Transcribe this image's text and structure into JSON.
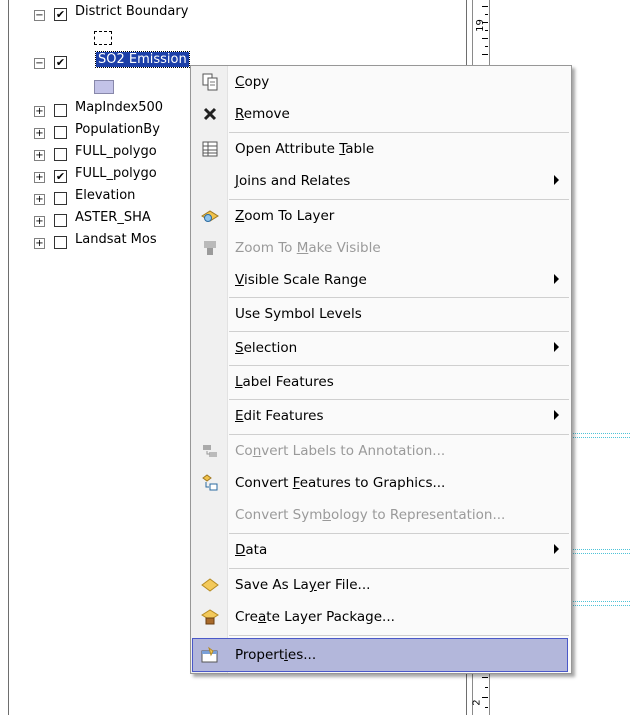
{
  "toc": {
    "layers": [
      {
        "name": "District Boundary",
        "checked": true,
        "expand": "minus"
      },
      {
        "name": "SO2 Emission",
        "checked": true,
        "expand": "minus",
        "selected": true
      },
      {
        "name": "MapIndex500",
        "checked": false,
        "expand": "plus"
      },
      {
        "name": "PopulationBy",
        "checked": false,
        "expand": "plus"
      },
      {
        "name": "FULL_polygo",
        "checked": false,
        "expand": "plus"
      },
      {
        "name": "FULL_polygo",
        "checked": true,
        "expand": "plus"
      },
      {
        "name": "Elevation",
        "checked": false,
        "expand": "plus"
      },
      {
        "name": "ASTER_SHA",
        "checked": false,
        "expand": "plus"
      },
      {
        "name": "Landsat Mos",
        "checked": false,
        "expand": "plus"
      }
    ],
    "check_glyph": "✔",
    "plus_glyph": "+",
    "minus_glyph": "−"
  },
  "ruler": {
    "top_number": "19",
    "bottom_number": "2"
  },
  "context_menu": {
    "items": [
      {
        "label": "Copy",
        "mnemonic": "C",
        "icon": "copy-icon",
        "enabled": true
      },
      {
        "label": "Remove",
        "mnemonic": "R",
        "icon": "remove-icon",
        "enabled": true
      },
      {
        "label": "Open Attribute Table",
        "mnemonic": "T",
        "icon": "table-icon",
        "enabled": true
      },
      {
        "label": "Joins and Relates",
        "mnemonic": "J",
        "enabled": true,
        "submenu": true
      },
      {
        "label": "Zoom To Layer",
        "mnemonic": "Z",
        "icon": "zoom-to-layer-icon",
        "enabled": true
      },
      {
        "label": "Zoom To Make Visible",
        "mnemonic": "M",
        "icon": "zoom-visible-icon",
        "enabled": false
      },
      {
        "label": "Visible Scale Range",
        "mnemonic": "V",
        "enabled": true,
        "submenu": true
      },
      {
        "label": "Use Symbol Levels",
        "mnemonic": "g",
        "enabled": true
      },
      {
        "label": "Selection",
        "mnemonic": "S",
        "enabled": true,
        "submenu": true
      },
      {
        "label": "Label Features",
        "mnemonic": "L",
        "enabled": true
      },
      {
        "label": "Edit Features",
        "mnemonic": "E",
        "enabled": true,
        "submenu": true
      },
      {
        "label": "Convert Labels to Annotation...",
        "mnemonic": "n",
        "icon": "convert-labels-icon",
        "enabled": false
      },
      {
        "label": "Convert Features to Graphics...",
        "mnemonic": "F",
        "icon": "convert-features-icon",
        "enabled": true
      },
      {
        "label": "Convert Symbology to Representation...",
        "mnemonic": "b",
        "enabled": false
      },
      {
        "label": "Data",
        "mnemonic": "D",
        "enabled": true,
        "submenu": true
      },
      {
        "label": "Save As Layer File...",
        "mnemonic": "y",
        "icon": "layer-file-icon",
        "enabled": true
      },
      {
        "label": "Create Layer Package...",
        "mnemonic": "a",
        "icon": "layer-package-icon",
        "enabled": true
      },
      {
        "label": "Properties...",
        "mnemonic": "i",
        "icon": "properties-icon",
        "enabled": true,
        "highlighted": true
      }
    ]
  },
  "colors": {
    "selection_bg": "#1c3fa8",
    "menu_highlight": "#b3b7db",
    "so2_swatch": "#c3c3e8"
  }
}
